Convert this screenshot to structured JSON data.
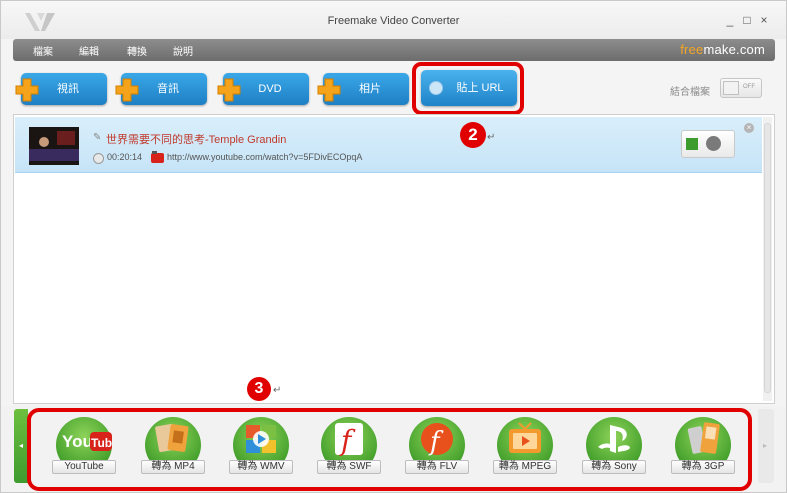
{
  "window": {
    "title": "Freemake Video Converter",
    "minimize": "_",
    "maximize": "□",
    "close": "×"
  },
  "menu": [
    "檔案",
    "編輯",
    "轉換",
    "說明"
  ],
  "brand": {
    "free": "free",
    "make": "make.com"
  },
  "toolbar": {
    "buttons": [
      "視訊",
      "音訊",
      "DVD",
      "相片"
    ],
    "paste_url": "貼上 URL",
    "merge_label": "結合檔案",
    "merge_toggle": "OFF"
  },
  "file": {
    "name": "世界需要不同的思考-Temple Grandin",
    "duration": "00:20:14",
    "url": "http://www.youtube.com/watch?v=5FDivECOpqA"
  },
  "markers": {
    "two": "2",
    "three": "3",
    "return_mark": "↵"
  },
  "formats": [
    {
      "label": "YouTube",
      "icon": "youtube-icon"
    },
    {
      "label": "轉為 MP4",
      "icon": "mp4-icon"
    },
    {
      "label": "轉為 WMV",
      "icon": "wmv-icon"
    },
    {
      "label": "轉為 SWF",
      "icon": "flash-icon"
    },
    {
      "label": "轉為 FLV",
      "icon": "flash-orange-icon"
    },
    {
      "label": "轉為 MPEG",
      "icon": "tv-icon"
    },
    {
      "label": "轉為 Sony",
      "icon": "playstation-icon"
    },
    {
      "label": "轉為 3GP",
      "icon": "phone-icon"
    }
  ],
  "colors": {
    "accent_blue": "#1e7fc4",
    "green": "#45a12c",
    "highlight_red": "#e10000",
    "file_title": "#c0392b"
  }
}
